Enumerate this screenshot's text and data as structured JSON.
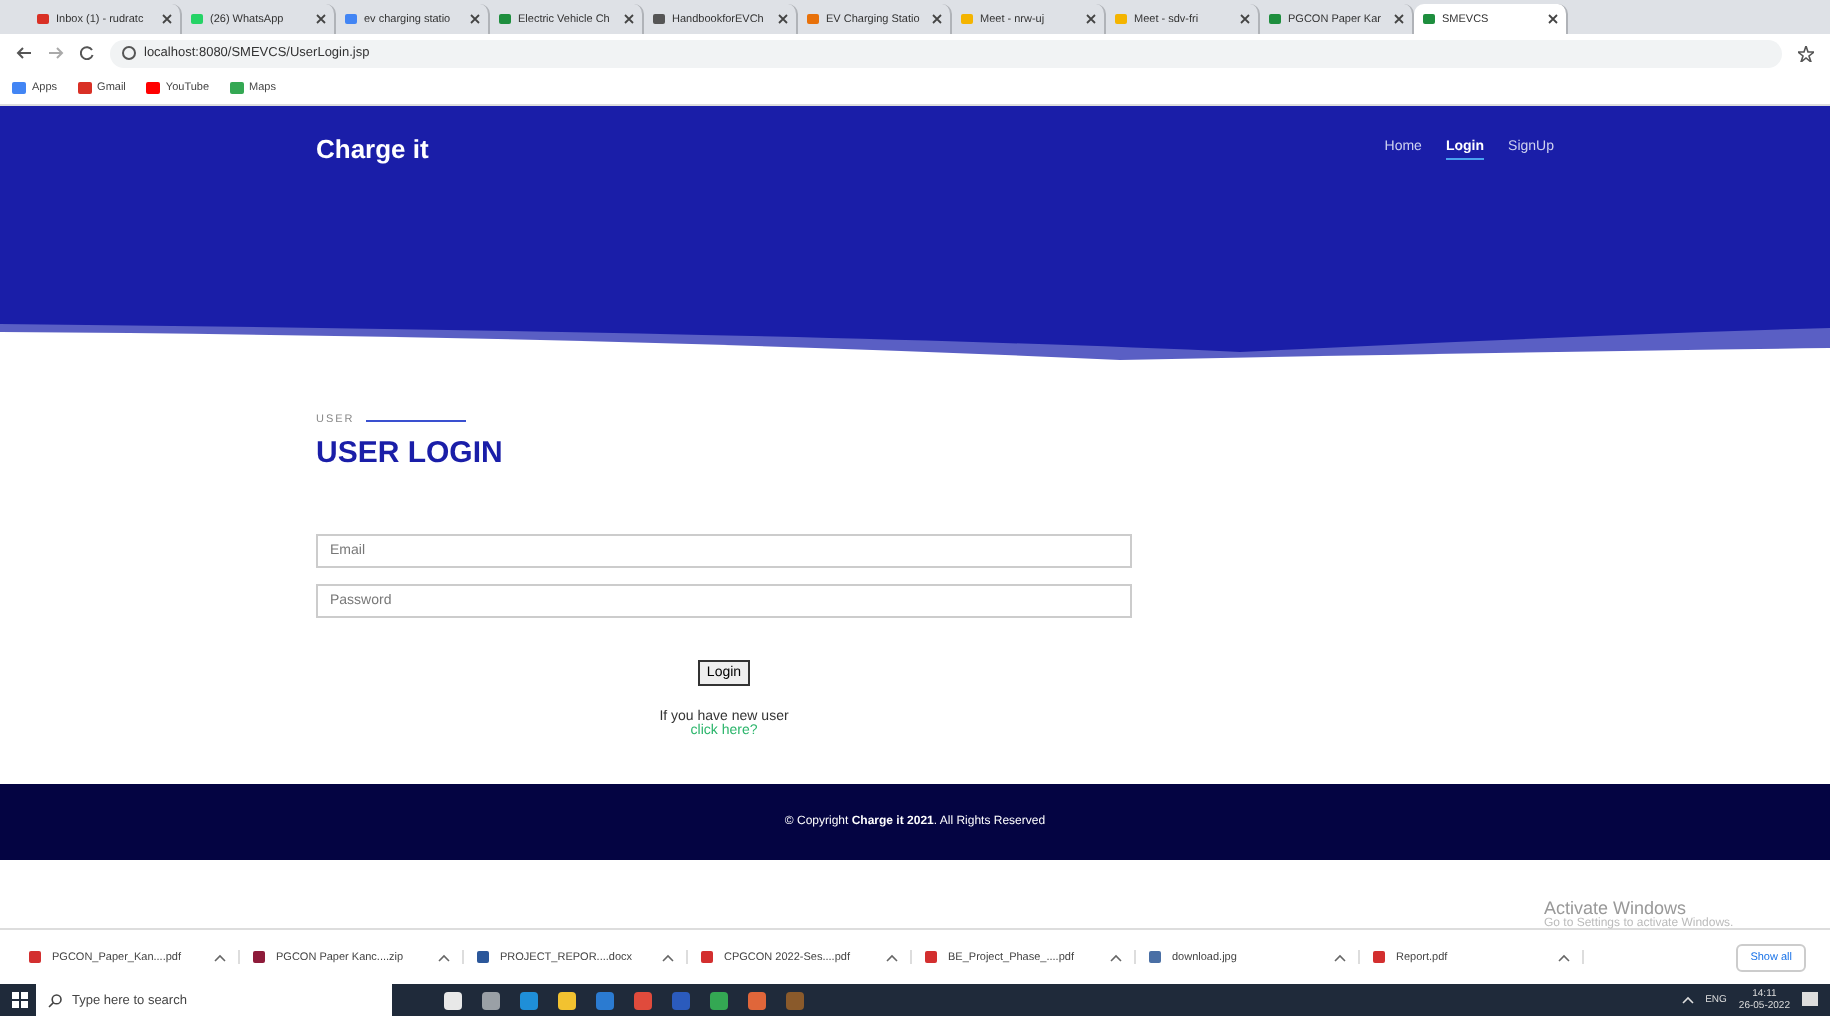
{
  "browser": {
    "tabs": [
      {
        "title": "Inbox (1) - rudratc",
        "selected": false
      },
      {
        "title": "(26) WhatsApp",
        "selected": false
      },
      {
        "title": "ev charging statio",
        "selected": false
      },
      {
        "title": "Electric Vehicle Ch",
        "selected": false
      },
      {
        "title": "HandbookforEVCh",
        "selected": false
      },
      {
        "title": "EV Charging Statio",
        "selected": false
      },
      {
        "title": "Meet - nrw-uj",
        "selected": false
      },
      {
        "title": "Meet - sdv-fri",
        "selected": false
      },
      {
        "title": "PGCON Paper Kar",
        "selected": false
      },
      {
        "title": "SMEVCS",
        "selected": true
      }
    ],
    "url": "localhost:8080/SMEVCS/UserLogin.jsp",
    "bookmarks": [
      "Apps",
      "Gmail",
      "YouTube",
      "Maps"
    ]
  },
  "site": {
    "brand": "Charge it",
    "nav": [
      {
        "label": "Home",
        "selected": false
      },
      {
        "label": "Login",
        "selected": true
      },
      {
        "label": "SignUp",
        "selected": false
      }
    ],
    "section_tag": "USER",
    "title": "USER LOGIN",
    "fields": [
      {
        "placeholder": "Email"
      },
      {
        "placeholder": "Password"
      }
    ],
    "submit": "Login",
    "prompt": "If you have new user",
    "link": "click here?",
    "footer": "© Copyright **Charge it 2021**. All Rights Reserved"
  },
  "downloads": {
    "items": [
      {
        "name": "PGCON_Paper_Kan....pdf",
        "kind": "pdf"
      },
      {
        "name": "PGCON Paper Kanc....zip",
        "kind": "zip"
      },
      {
        "name": "PROJECT_REPOR....docx",
        "kind": "doc"
      },
      {
        "name": "CPGCON 2022-Ses....pdf",
        "kind": "pdf"
      },
      {
        "name": "BE_Project_Phase_....pdf",
        "kind": "pdf"
      },
      {
        "name": "download.jpg",
        "kind": "img"
      },
      {
        "name": "Report.pdf",
        "kind": "pdf"
      }
    ],
    "show_all": "Show all"
  },
  "watermark": {
    "title": "Activate Windows",
    "subtitle": "Go to Settings to activate Windows."
  },
  "taskbar": {
    "search": "Type here to search",
    "language": "ENG",
    "time": "14:11",
    "date": "26-05-2022"
  }
}
